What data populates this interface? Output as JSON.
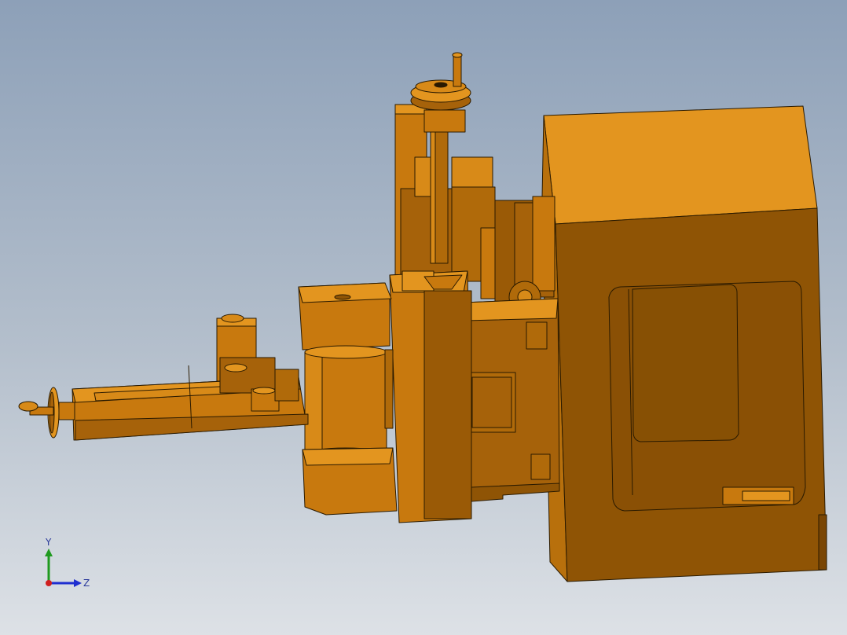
{
  "colors": {
    "background_top": "#8da0b8",
    "background_bottom": "#dde1e6",
    "part_light": "#e3951f",
    "part_mid": "#c8790e",
    "part_dark": "#8f5405",
    "edge": "#2a1a00",
    "axis_y": "#1f9a1f",
    "axis_z": "#1f2fd0",
    "axis_x": "#d01f1f"
  },
  "triad": {
    "y_label": "Y",
    "z_label": "Z"
  }
}
